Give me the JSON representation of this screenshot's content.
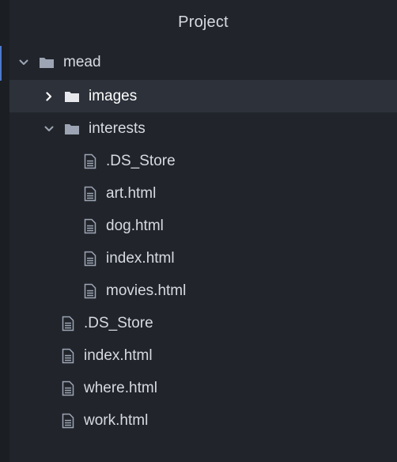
{
  "panel": {
    "title": "Project"
  },
  "tree": {
    "root": {
      "label": "mead",
      "expanded": true
    },
    "images": {
      "label": "images",
      "expanded": false,
      "selected": true
    },
    "interests": {
      "label": "interests",
      "expanded": true,
      "files": [
        ".DS_Store",
        "art.html",
        "dog.html",
        "index.html",
        "movies.html"
      ]
    },
    "root_files": [
      ".DS_Store",
      "index.html",
      "where.html",
      "work.html"
    ]
  },
  "colors": {
    "background": "#21252b",
    "selected_row": "#2c313a",
    "text": "#d7dae0",
    "accent": "#4d78cc",
    "icon": "#9da5b4"
  }
}
